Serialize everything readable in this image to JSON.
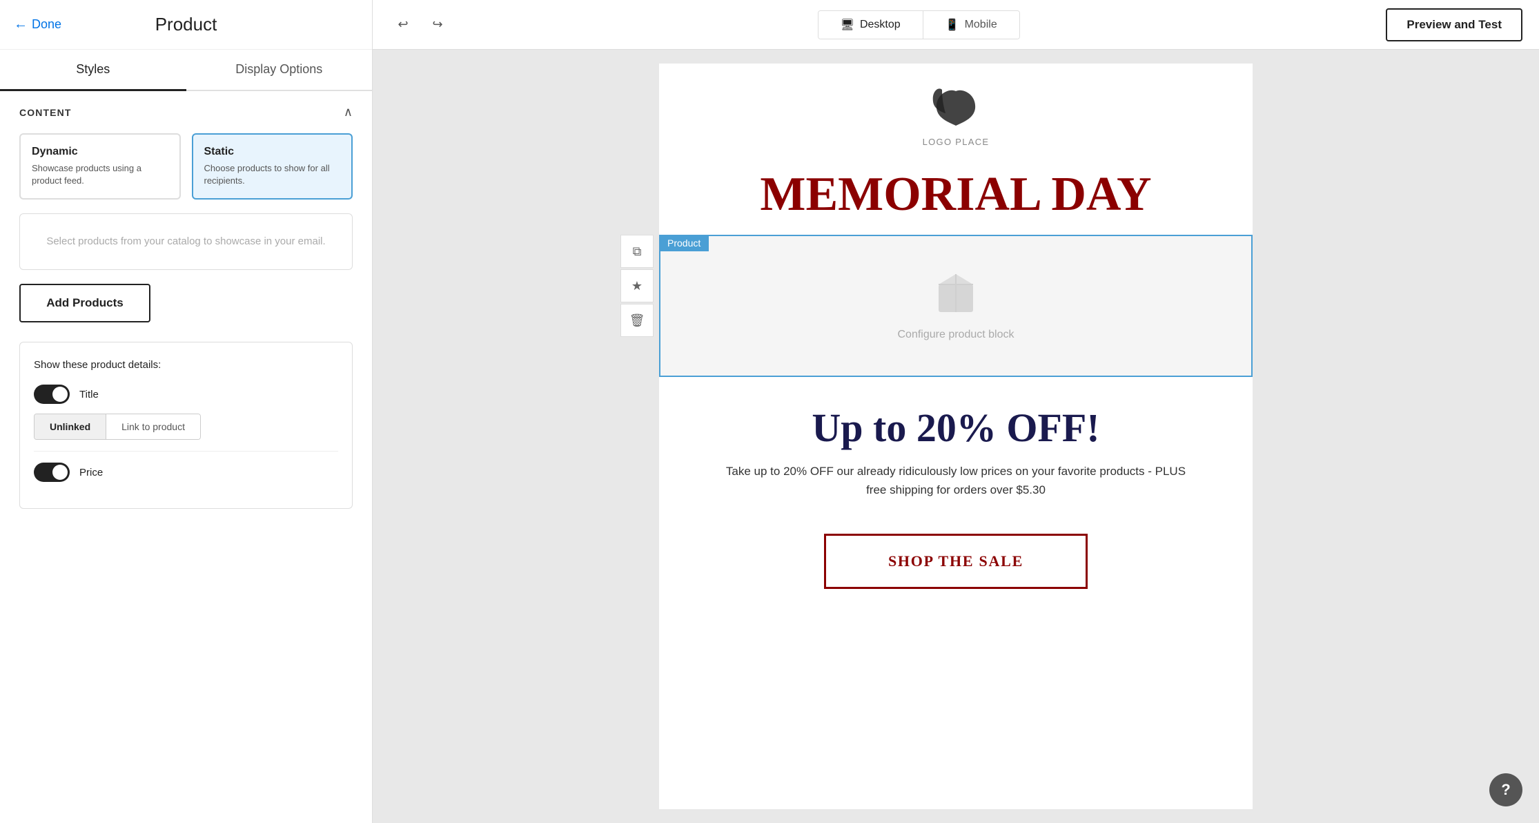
{
  "header": {
    "done_label": "Done",
    "title": "Product"
  },
  "tabs": {
    "styles_label": "Styles",
    "display_options_label": "Display Options"
  },
  "sidebar": {
    "content_section_title": "CONTENT",
    "dynamic_card": {
      "title": "Dynamic",
      "description": "Showcase products using a product feed."
    },
    "static_card": {
      "title": "Static",
      "description": "Choose products to show for all recipients."
    },
    "product_select_placeholder": "Select products from your catalog to showcase in your email.",
    "add_products_label": "Add Products",
    "product_details_title": "Show these product details:",
    "title_toggle_label": "Title",
    "title_toggle_on": true,
    "link_unlinked_label": "Unlinked",
    "link_to_product_label": "Link to product",
    "price_toggle_label": "Price",
    "price_toggle_on": true
  },
  "top_bar": {
    "undo_icon": "↩",
    "redo_icon": "↪",
    "desktop_label": "Desktop",
    "mobile_label": "Mobile",
    "preview_test_label": "Preview and Test"
  },
  "email_preview": {
    "logo_text": "LOGO PLACE",
    "headline": "MEMORIAL DAY",
    "product_label": "Product",
    "product_block_text": "Configure product block",
    "discount_heading": "Up to 20% OFF!",
    "discount_body": "Take up to 20% OFF our already ridiculously low prices on your favorite products - PLUS free shipping for orders over $5.30",
    "cta_label": "SHOP THE SALE"
  },
  "colors": {
    "accent_blue": "#4a9fd5",
    "dark_red": "#8b0000",
    "navy": "#1a1a4e",
    "done_color": "#0073e6"
  }
}
